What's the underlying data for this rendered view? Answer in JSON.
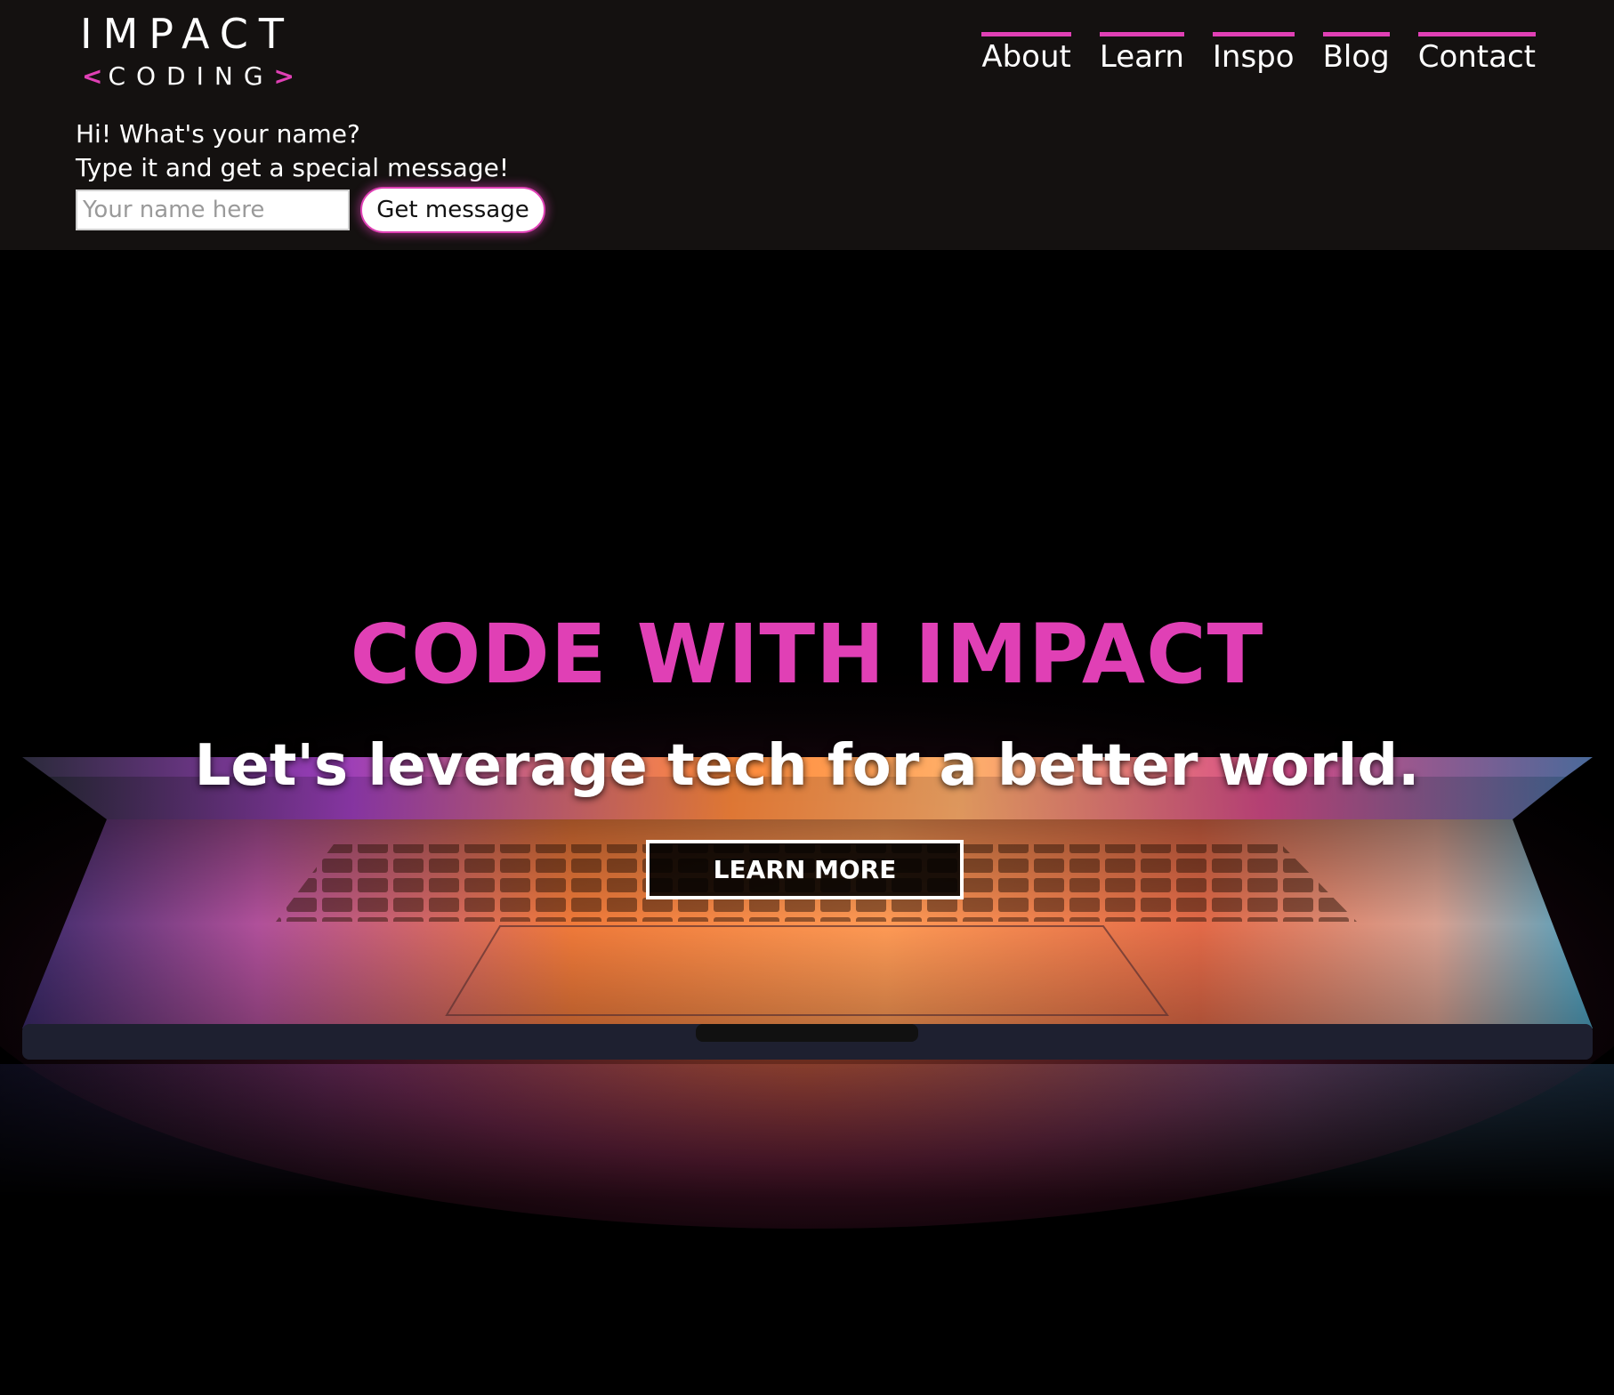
{
  "logo": {
    "main": "IMPACT",
    "sub_left": "<",
    "sub_word": "CODING",
    "sub_right": ">"
  },
  "nav": {
    "items": [
      "About",
      "Learn",
      "Inspo",
      "Blog",
      "Contact"
    ]
  },
  "greeting": {
    "line1": "Hi! What's your name?",
    "line2": "Type it and get a special message!",
    "input_placeholder": "Your name here",
    "input_value": "",
    "button_label": "Get message"
  },
  "hero": {
    "title": "CODE WITH IMPACT",
    "subtitle": "Let's leverage tech for a better world.",
    "cta_label": "LEARN MORE"
  },
  "colors": {
    "accent": "#e040b5",
    "header_bg": "#141110",
    "hero_bg": "#000000",
    "text": "#ffffff"
  }
}
